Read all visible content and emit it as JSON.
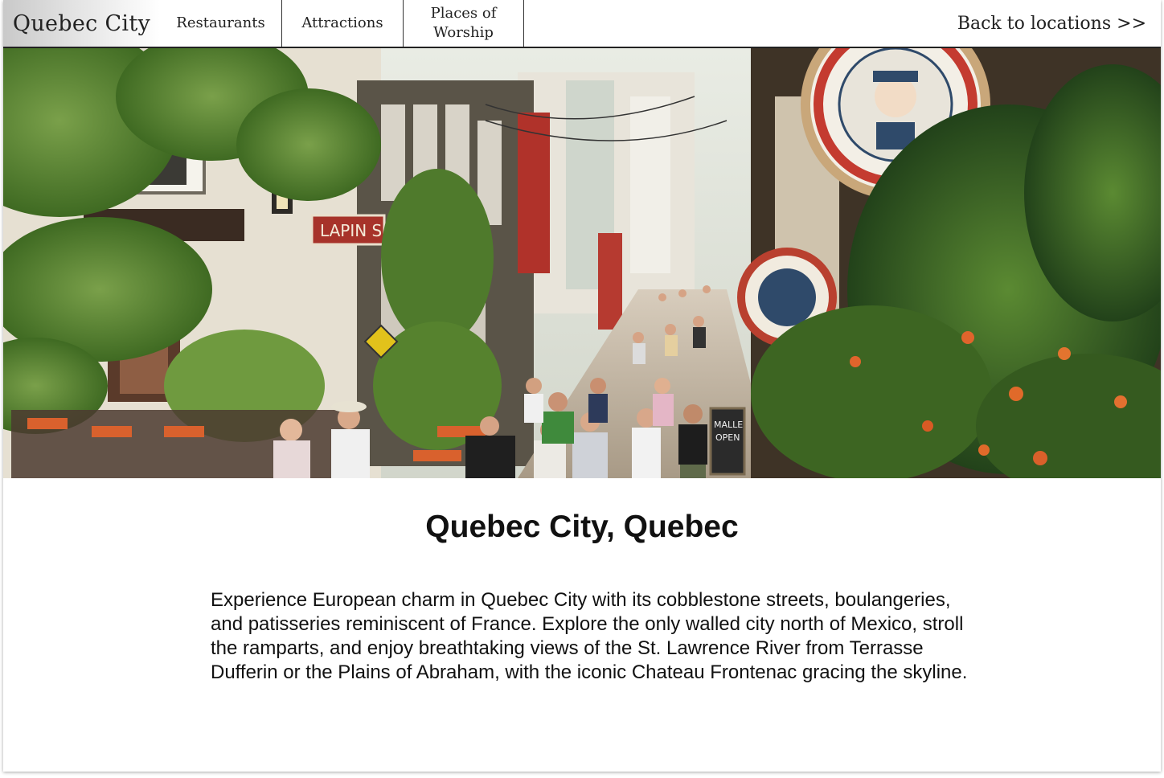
{
  "nav": {
    "brand": "Quebec City",
    "tabs": [
      {
        "label": "Restaurants"
      },
      {
        "label": "Attractions"
      },
      {
        "label": "Places of Worship"
      }
    ],
    "back_link": "Back to locations >>"
  },
  "hero": {
    "alt": "Street scene in Old Quebec City",
    "signs": {
      "lapin": "LAPIN S",
      "board_line1": "MALLE",
      "board_line2": "OPEN"
    }
  },
  "main": {
    "title": "Quebec City, Quebec",
    "description": "Experience European charm in Quebec City with its cobblestone streets, boulangeries, and patisseries reminiscent of France. Explore the only walled city north of Mexico, stroll the ramparts, and enjoy breathtaking views of the St. Lawrence River from Terrasse Dufferin or the Plains of Abraham, with the iconic Chateau Frontenac gracing the skyline."
  },
  "colors": {
    "nav_border": "#222222",
    "text": "#111111",
    "foliage": "#4f7a2c",
    "sign_red": "#b0322a"
  }
}
